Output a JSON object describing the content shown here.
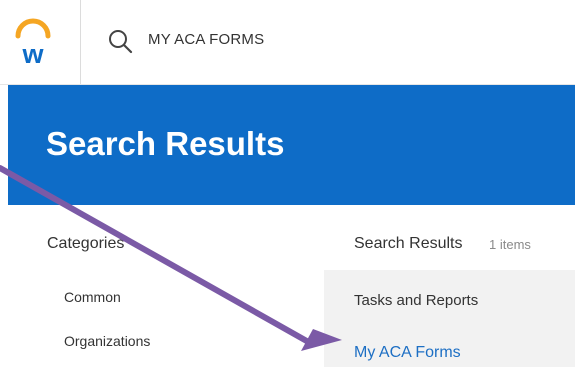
{
  "header": {
    "logo_icon": "workday-logo-icon",
    "search_icon": "search-icon",
    "search_query": "MY ACA FORMS"
  },
  "banner": {
    "title": "Search Results",
    "color": "#0e6cc7"
  },
  "categories": {
    "title": "Categories",
    "items": [
      {
        "label": "Common"
      },
      {
        "label": "Organizations"
      }
    ]
  },
  "results": {
    "title": "Search Results",
    "count": "1 items",
    "group_label": "Tasks and Reports",
    "items": [
      {
        "label": "My ACA Forms"
      }
    ]
  },
  "annotation": {
    "arrow_icon": "pointer-arrow-icon",
    "arrow_color": "#7b5aa6"
  }
}
